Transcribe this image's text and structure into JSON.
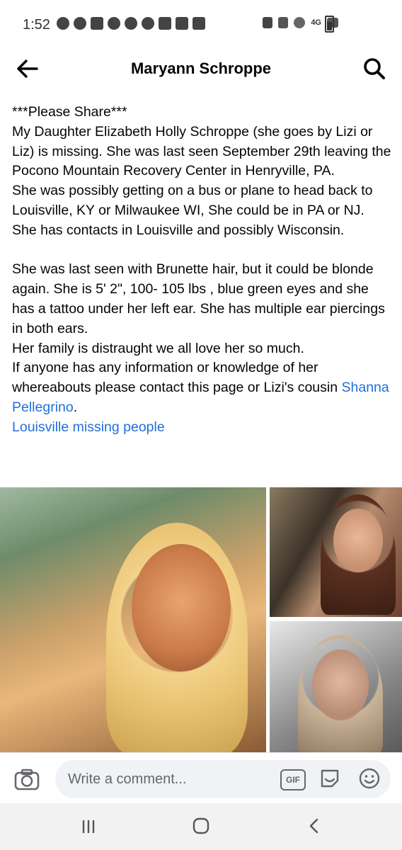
{
  "status_bar": {
    "time": "1:52",
    "network": "4G"
  },
  "header": {
    "title": "Maryann Schroppe"
  },
  "post": {
    "lines": [
      "***Please Share***",
      "My Daughter Elizabeth Holly Schroppe (she goes by Lizi or Liz) is missing. She was last seen September 29th leaving the Pocono Mountain Recovery Center in Henryville, PA.",
      "She was possibly getting on a bus or plane to head back to Louisville, KY or Milwaukee WI, She could be in PA or NJ.",
      "She has contacts in Louisville and possibly Wisconsin.",
      "She was last seen with Brunette hair,  but it could be blonde again. She is 5' 2\",  100- 105 lbs , blue green eyes and she has a tattoo under her left ear. She has multiple ear piercings in both ears.",
      "Her family is distraught we all love her so much.",
      "If anyone has any information or knowledge of her whereabouts please contact this page or Lizi's cousin"
    ],
    "cousin_link": "Shanna Pellegrino",
    "cousin_suffix": ".",
    "page_link": "Louisville missing people"
  },
  "comment": {
    "placeholder": "Write a comment...",
    "gif_label": "GIF"
  },
  "colors": {
    "link": "#216fdb",
    "text": "#050505",
    "muted": "#65676b"
  },
  "icons": [
    "back-arrow-icon",
    "search-icon",
    "camera-icon",
    "gif-icon",
    "sticker-icon",
    "emoji-icon",
    "recents-icon",
    "home-icon",
    "nav-back-icon"
  ]
}
